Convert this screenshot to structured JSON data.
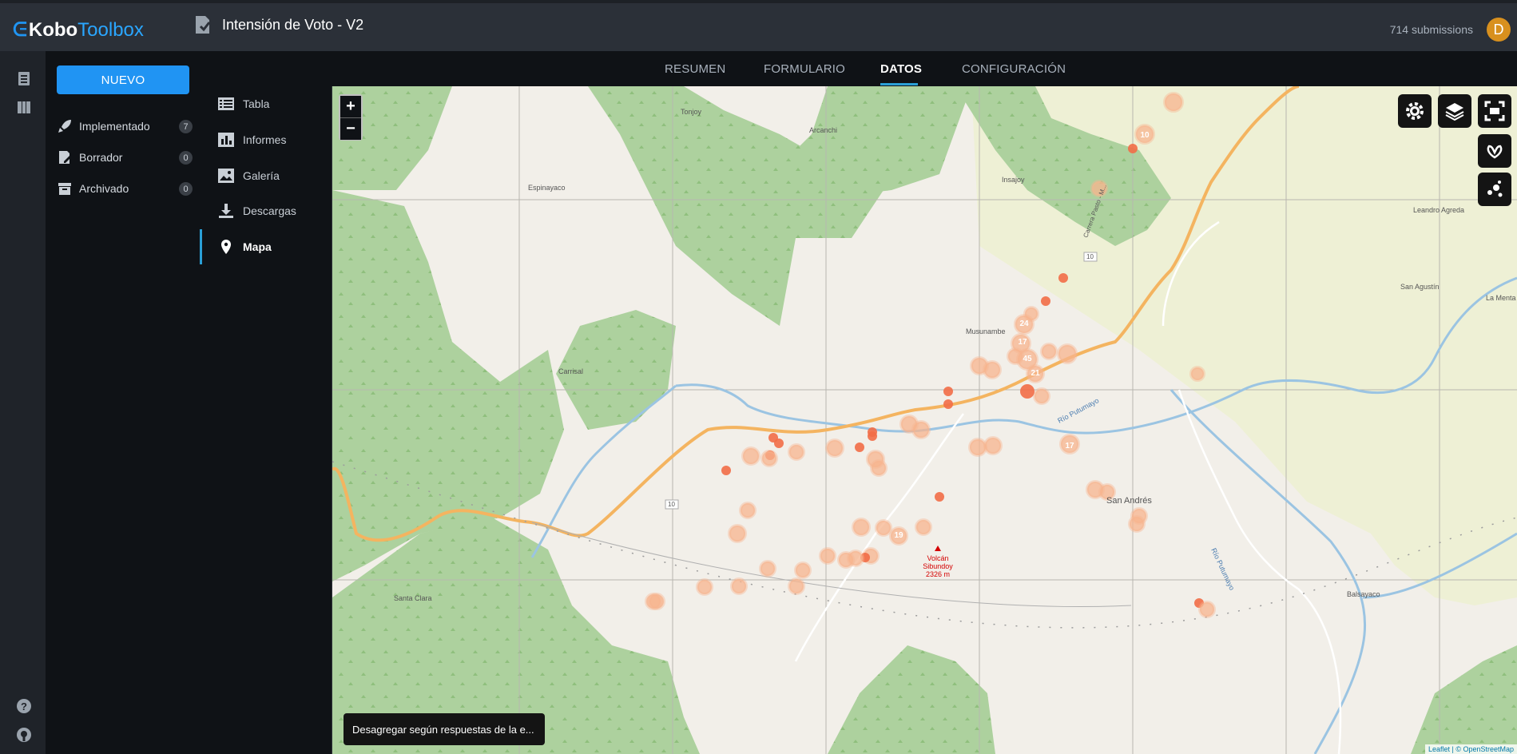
{
  "app": {
    "brand_prefix": "Kobo",
    "brand_suffix": "Toolbox",
    "project_title": "Intensión de Voto - V2",
    "submissions": "714 submissions",
    "avatar_letter": "D"
  },
  "left": {
    "new_label": "NUEVO",
    "items": [
      {
        "label": "Implementado",
        "count": "7"
      },
      {
        "label": "Borrador",
        "count": "0"
      },
      {
        "label": "Archivado",
        "count": "0"
      }
    ]
  },
  "tabs": [
    "RESUMEN",
    "FORMULARIO",
    "DATOS",
    "CONFIGURACIÓN"
  ],
  "subnav": [
    "Tabla",
    "Informes",
    "Galería",
    "Descargas",
    "Mapa"
  ],
  "map": {
    "zoom_in": "+",
    "zoom_out": "−",
    "disaggregate": "Desagregar según respuestas de la e...",
    "attribution": "Leaflet | © OpenStreetMap",
    "places": [
      "Tonjoy",
      "Arcanchi",
      "Espinayaco",
      "Insajoy",
      "Carrisal",
      "Musunambe",
      "Leandro Agreda",
      "San Agustín",
      "La Menta",
      "San Andrés",
      "Santa Clara",
      "Balsayaco"
    ],
    "peak": [
      "Volcán",
      "Sibundoy",
      "2326 m"
    ],
    "rivers": [
      "Río Putumayo",
      "Río Putumayo"
    ],
    "road_refs": [
      "10",
      "10"
    ],
    "road_name": "Carrera Pasto - M...",
    "cluster_labels": [
      "10",
      "24",
      "17",
      "45",
      "21",
      "17",
      "19"
    ]
  },
  "colors": {
    "accent": "#2094f3",
    "tab_active": "#2a9fd6",
    "forest": "#add19e",
    "farmland": "#eef0d5",
    "road": "#f4b460",
    "river": "#9bc4e2",
    "marker": "#f26d47",
    "cluster": "#f7b48e"
  }
}
